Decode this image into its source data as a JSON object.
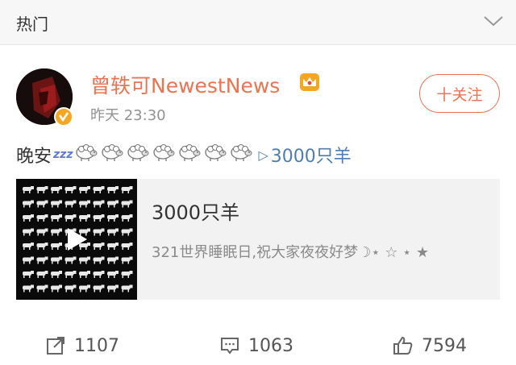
{
  "header": {
    "title": "热门",
    "icon": "chevron-down-icon"
  },
  "post": {
    "author": "曾轶可NewestNews",
    "time": "昨天 23:30",
    "follow_label": "十关注",
    "text_prefix": "晚安",
    "zzz": "zzz",
    "sheep_count": 7,
    "link_text": "3000只羊",
    "link_icon": "play-triangle-icon",
    "media": {
      "title": "3000只羊",
      "description": "321世界睡眠日,祝大家夜夜好梦☽⋆ ☆ ⋆ ★"
    },
    "actions": {
      "repost": "1107",
      "comment": "1063",
      "like": "7594"
    }
  },
  "colors": {
    "accent": "#eb7350",
    "link": "#507daf",
    "vip": "#f5a623"
  }
}
